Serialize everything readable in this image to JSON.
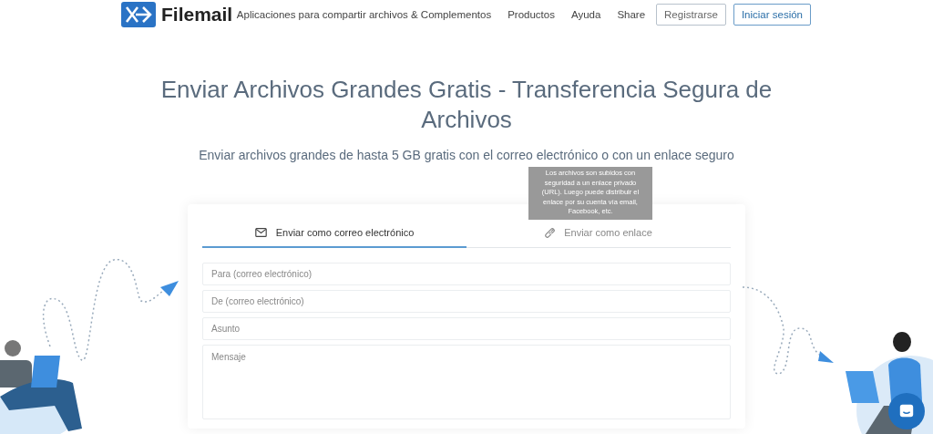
{
  "header": {
    "logo": "Filemail",
    "nav": [
      "Aplicaciones para compartir archivos & Complementos",
      "Productos",
      "Ayuda",
      "Share"
    ],
    "buttons": [
      "Registrarse",
      "Iniciar sesión"
    ]
  },
  "title": "Enviar Archivos Grandes Gratis - Transferencia Segura de Archivos",
  "subtitle": "Enviar archivos grandes de hasta 5 GB gratis con el correo electrónico o con un enlace seguro",
  "tabs": [
    {
      "label": "Enviar como correo electrónico",
      "kind": "email",
      "selected": true
    },
    {
      "label": "Enviar como enlace",
      "kind": "link",
      "selected": false
    }
  ],
  "tooltip": "Los archivos son subidos con seguridad a un enlace privado (URL). Luego puede distribuir el enlace por su cuenta vía email, Facebook, etc.",
  "fields": [
    {
      "placeholder": "Para (correo electrónico)",
      "kind": "input"
    },
    {
      "placeholder": "De (correo electrónico)",
      "kind": "input"
    },
    {
      "placeholder": "Asunto",
      "kind": "input"
    },
    {
      "placeholder": "Mensaje",
      "kind": "textarea"
    }
  ]
}
